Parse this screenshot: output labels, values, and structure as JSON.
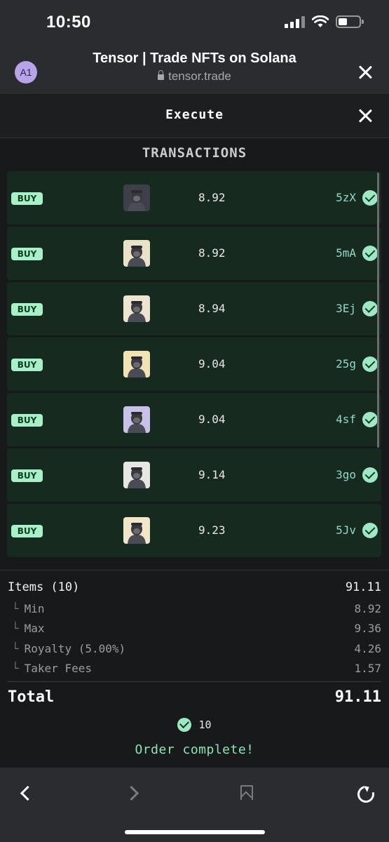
{
  "status": {
    "time": "10:50"
  },
  "browser": {
    "avatar": "A1",
    "title": "Tensor | Trade NFTs on Solana",
    "url": "tensor.trade"
  },
  "modal": {
    "title": "Execute",
    "section_title": "TRANSACTIONS"
  },
  "transactions": [
    {
      "type": "BUY",
      "price": "8.92",
      "sig": "5zX",
      "thumb_color": "#3d3f4a"
    },
    {
      "type": "BUY",
      "price": "8.92",
      "sig": "5mA",
      "thumb_color": "#e8e2c9"
    },
    {
      "type": "BUY",
      "price": "8.94",
      "sig": "3Ej",
      "thumb_color": "#ede5cf"
    },
    {
      "type": "BUY",
      "price": "9.04",
      "sig": "25g",
      "thumb_color": "#f1e3b3"
    },
    {
      "type": "BUY",
      "price": "9.04",
      "sig": "4sf",
      "thumb_color": "#c9c2e8"
    },
    {
      "type": "BUY",
      "price": "9.14",
      "sig": "3go",
      "thumb_color": "#e6e6e3"
    },
    {
      "type": "BUY",
      "price": "9.23",
      "sig": "5Jv",
      "thumb_color": "#f1e6c8"
    }
  ],
  "summary": {
    "items_label": "Items (10)",
    "items_value": "91.11",
    "min_label": "Min",
    "min_value": "8.92",
    "max_label": "Max",
    "max_value": "9.36",
    "royalty_label": "Royalty (5.00%)",
    "royalty_value": "4.26",
    "taker_label": "Taker Fees",
    "taker_value": "1.57",
    "total_label": "Total",
    "total_value": "91.11",
    "completed_count": "10",
    "complete_message": "Order complete!"
  },
  "colors": {
    "row_bg": "#172a20",
    "badge_bg": "#a7f0c8",
    "accent_green": "#8fe3b5",
    "sig_color": "#8fd9c9"
  },
  "toolbar": [
    "back-icon",
    "forward-icon",
    "bookmark-icon",
    "reload-icon"
  ]
}
